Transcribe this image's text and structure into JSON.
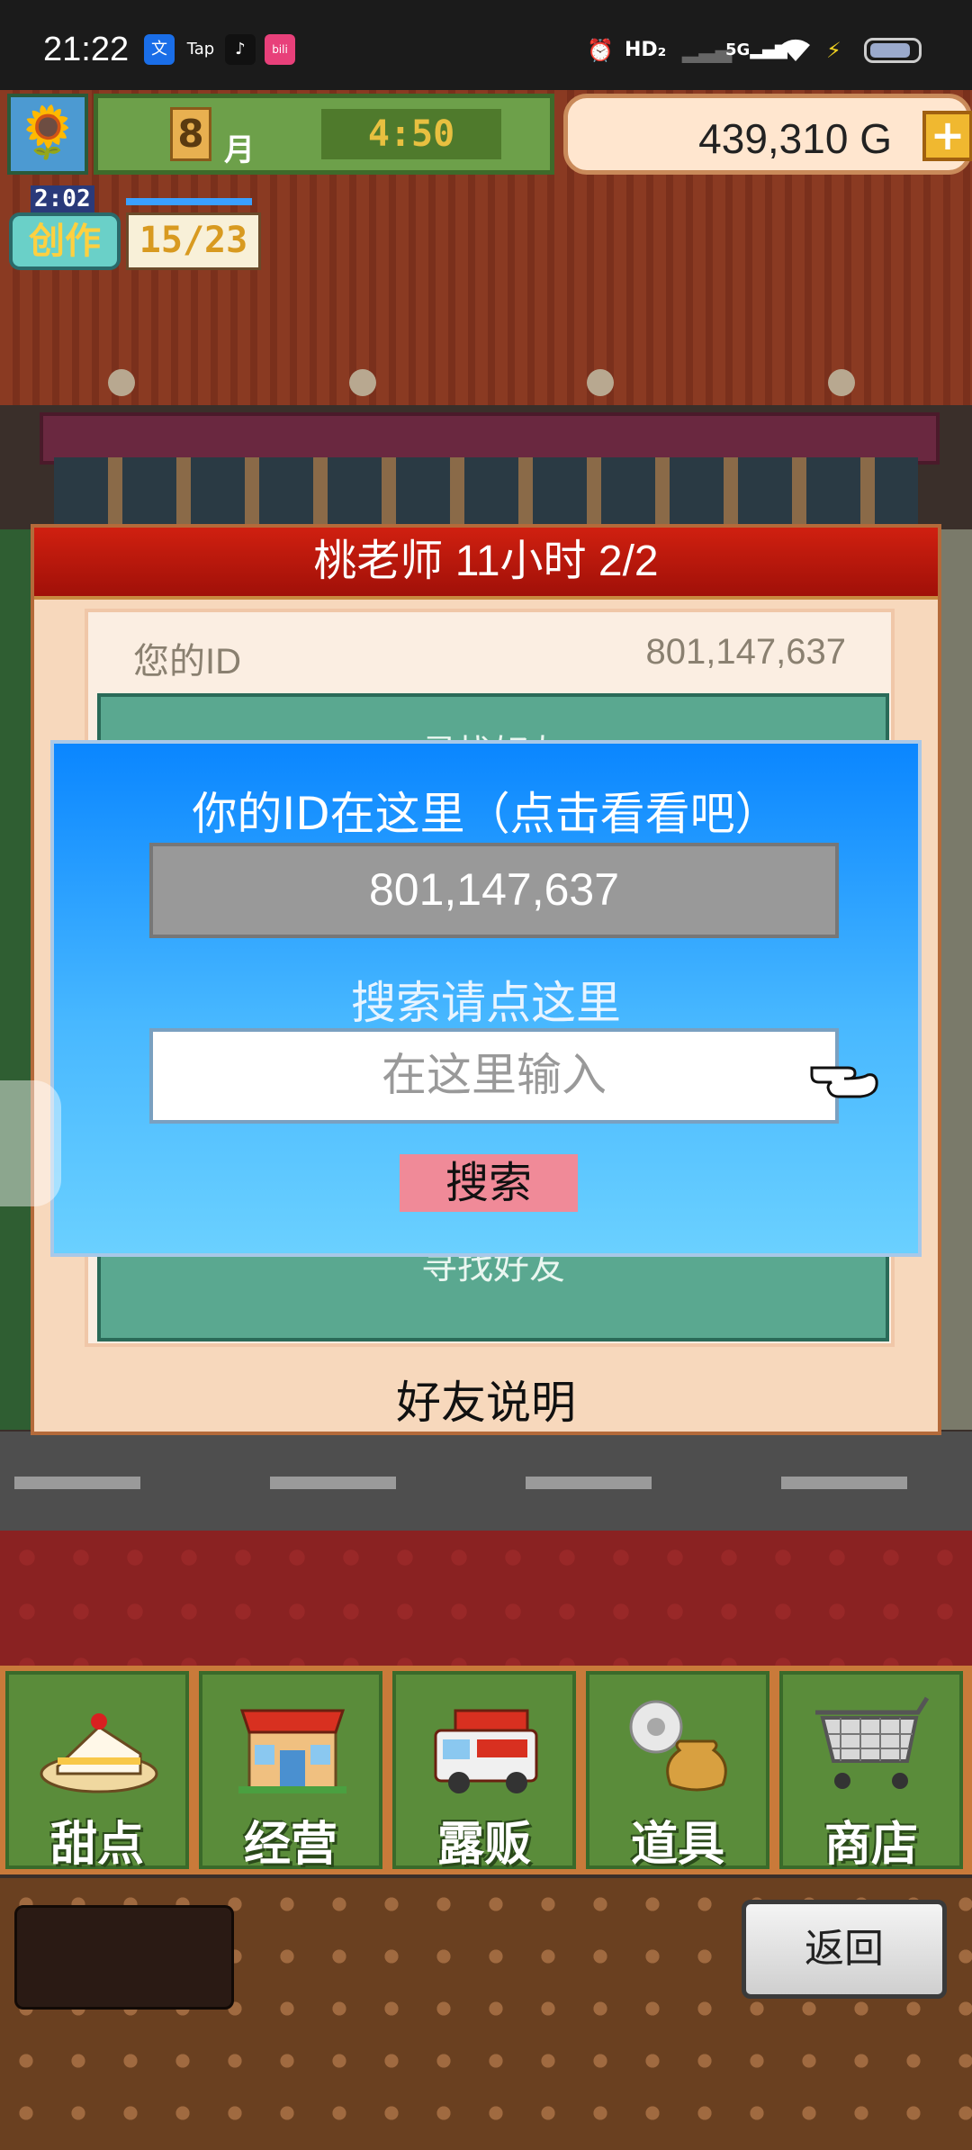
{
  "status_bar": {
    "time": "21:22",
    "apps": [
      "文",
      "Tap",
      "♪",
      "bili"
    ],
    "indicators": {
      "hd": "HD₂",
      "network": "5G"
    }
  },
  "hud": {
    "month_number": "8",
    "month_label": "月",
    "clock": "4:50",
    "money": "439,310 G",
    "plus_label": "+"
  },
  "create_badge": {
    "timer": "2:02",
    "label": "创作",
    "count": "15/23"
  },
  "friend_panel": {
    "header": "桃老师  11小时 2/2",
    "id_label": "您的ID",
    "id_value": "801,147,637",
    "teal_top_label": "寻找好友",
    "teal_bottom_label": "寻找好友",
    "explain": "好友说明"
  },
  "search_dialog": {
    "title": "你的ID在这里（点击看看吧）",
    "my_id": "801,147,637",
    "search_hint": "搜索请点这里",
    "input_placeholder": "在这里输入",
    "search_button": "搜索"
  },
  "menu": {
    "items": [
      {
        "label": "甜点",
        "icon": "cake-icon"
      },
      {
        "label": "经营",
        "icon": "shop-building-icon"
      },
      {
        "label": "露贩",
        "icon": "food-truck-icon"
      },
      {
        "label": "道具",
        "icon": "items-bag-icon"
      },
      {
        "label": "商店",
        "icon": "shopping-cart-icon"
      }
    ]
  },
  "footer": {
    "back_button": "返回"
  },
  "colors": {
    "dialog_blue": "#0a86ff",
    "panel_header_red": "#c01810",
    "menu_green": "#5a8c3a",
    "search_button_pink": "#f08a98"
  }
}
